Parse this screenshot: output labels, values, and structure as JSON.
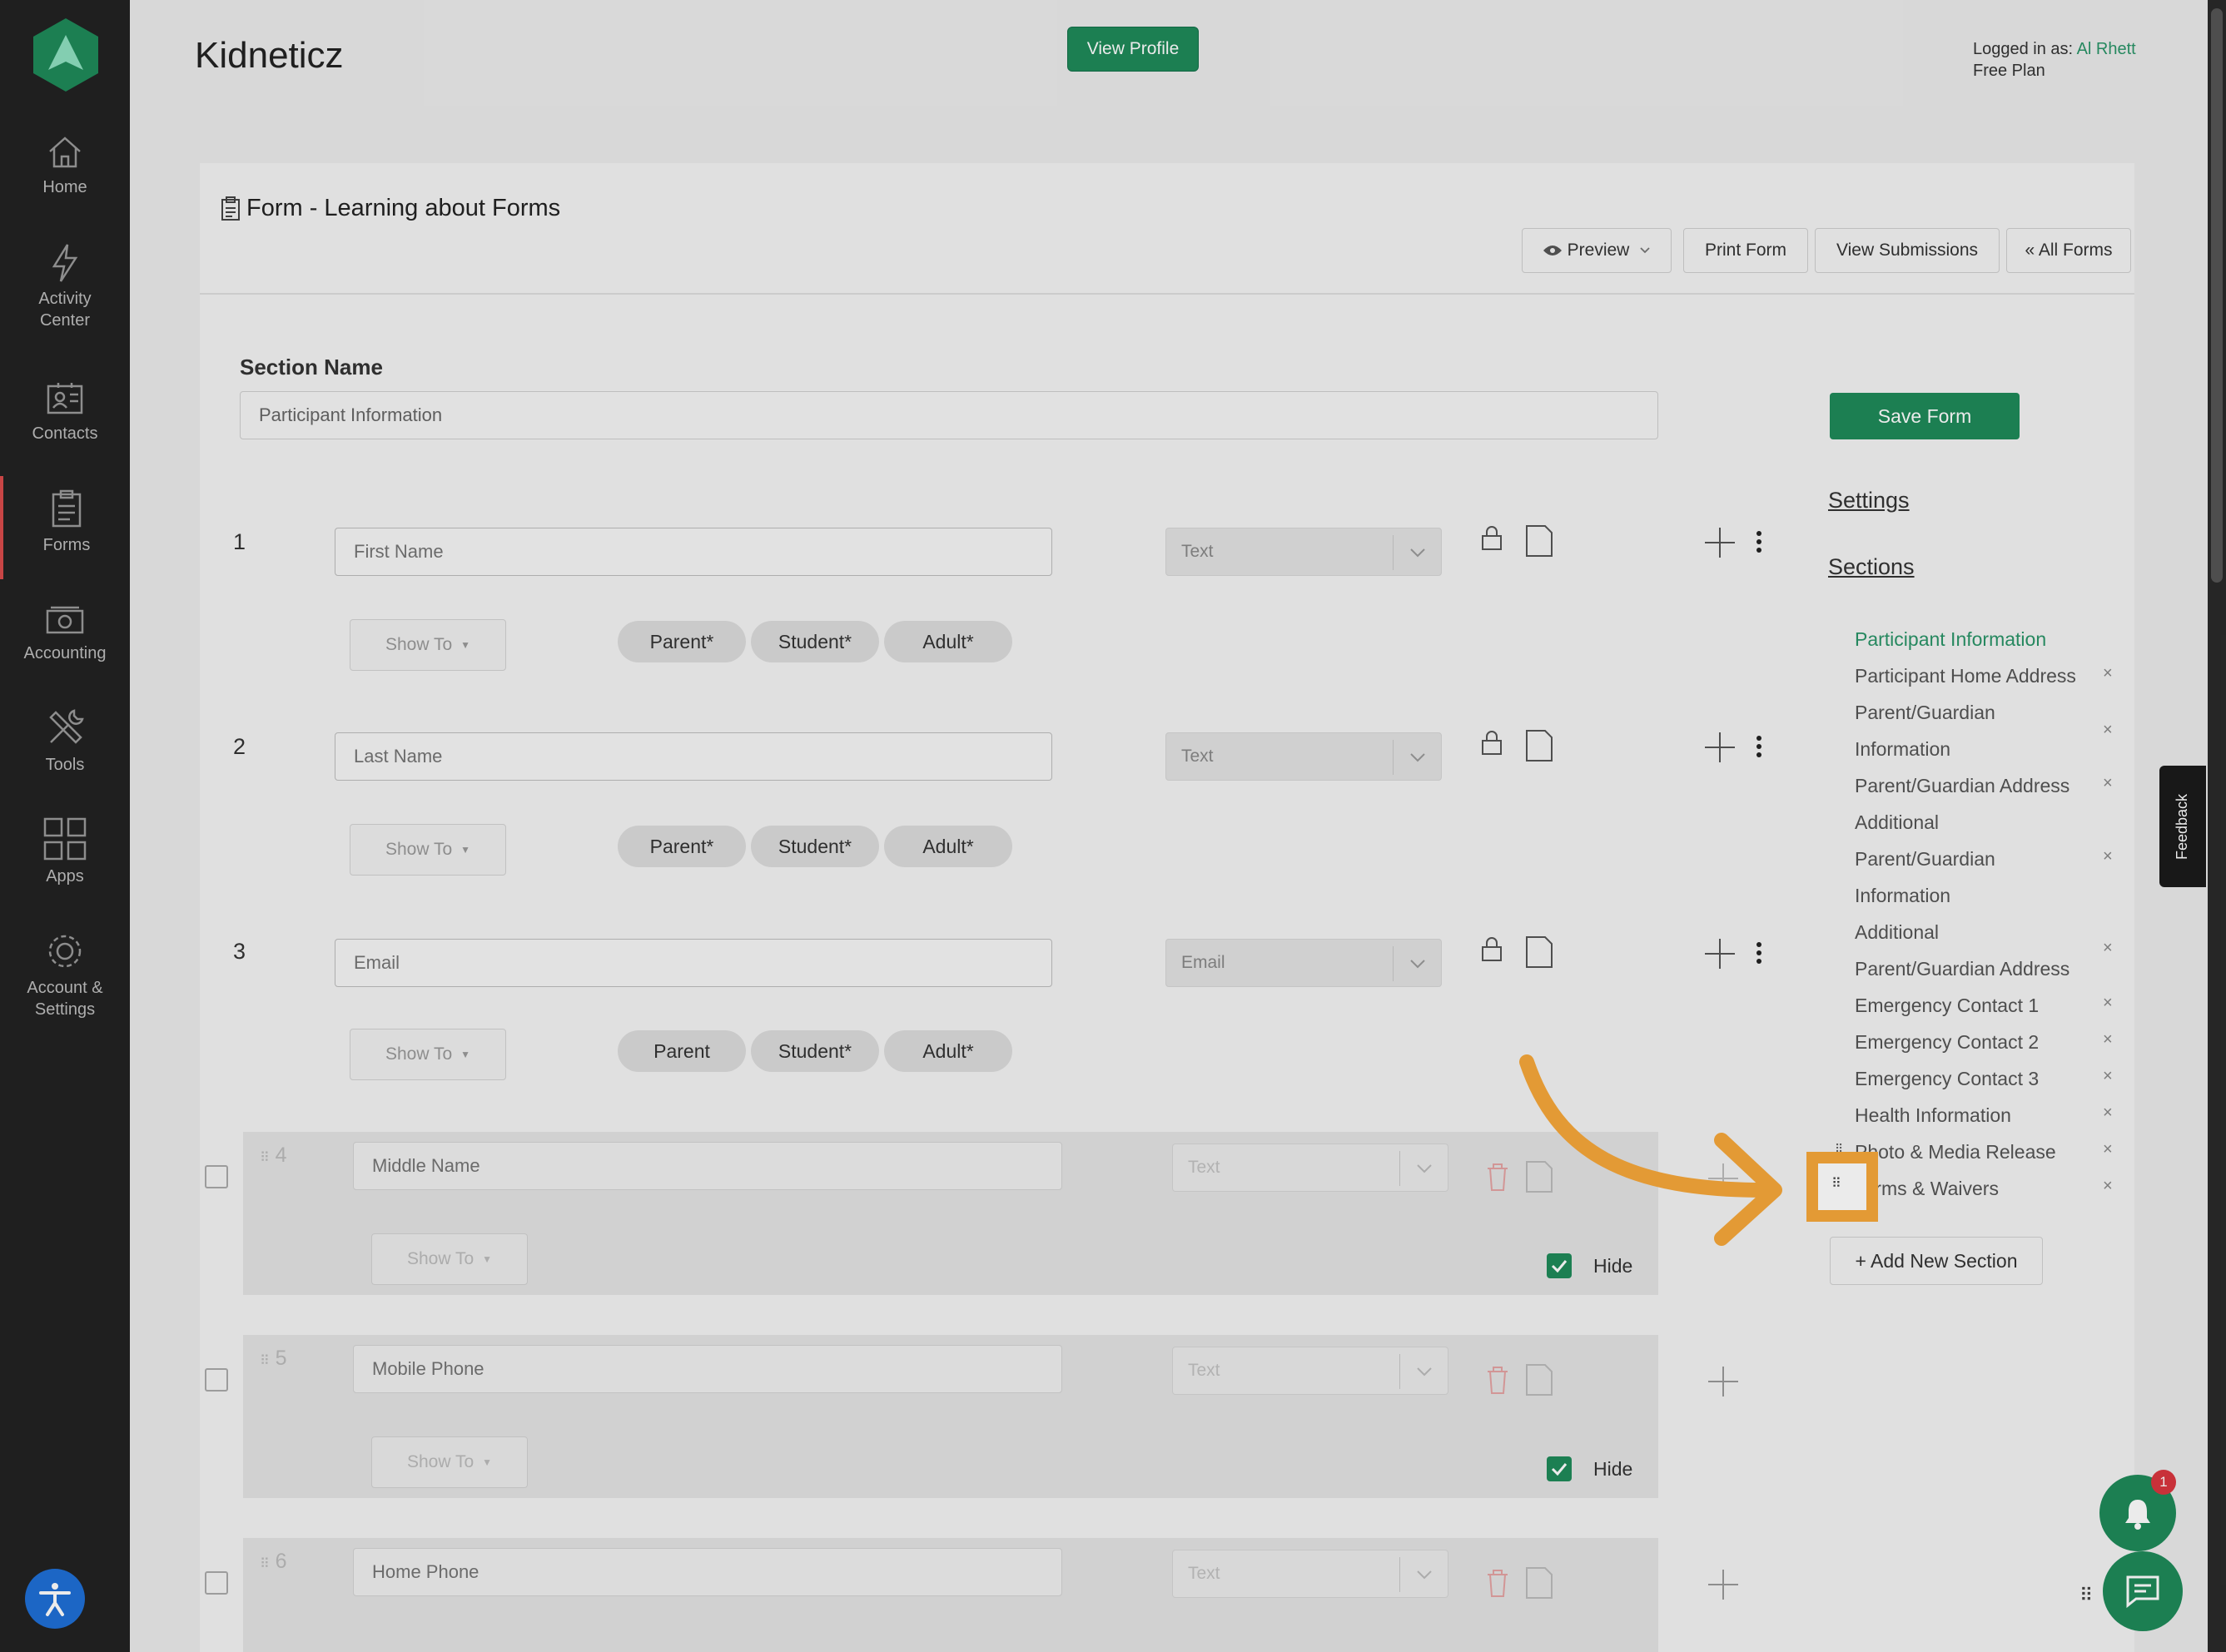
{
  "sidebar": {
    "items": [
      {
        "label": "Home",
        "icon": "home-icon"
      },
      {
        "label": "Activity Center",
        "icon": "bolt-icon"
      },
      {
        "label": "Contacts",
        "icon": "contacts-icon"
      },
      {
        "label": "Forms",
        "icon": "clipboard-icon"
      },
      {
        "label": "Accounting",
        "icon": "money-icon"
      },
      {
        "label": "Tools",
        "icon": "tools-icon"
      },
      {
        "label": "Apps",
        "icon": "apps-grid-icon"
      },
      {
        "label": "Account & Settings",
        "icon": "gear-icon"
      }
    ]
  },
  "header": {
    "title": "Kidneticz",
    "view_profile": "View Profile",
    "logged_in_prefix": "Logged in as:",
    "user": "Al Rhett",
    "plan": "Free Plan"
  },
  "form": {
    "title": "Form - Learning about Forms",
    "buttons": {
      "preview": "Preview",
      "print": "Print Form",
      "submissions": "View Submissions",
      "all_forms": "« All Forms"
    },
    "section_name_label": "Section Name",
    "section_name_value": "Participant Information",
    "save": "Save Form",
    "show_to": "Show To",
    "hide_label": "Hide",
    "fields": [
      {
        "num": "1",
        "placeholder": "First Name",
        "type": "Text",
        "chips": [
          "Parent*",
          "Student*",
          "Adult*"
        ]
      },
      {
        "num": "2",
        "placeholder": "Last Name",
        "type": "Text",
        "chips": [
          "Parent*",
          "Student*",
          "Adult*"
        ]
      },
      {
        "num": "3",
        "placeholder": "Email",
        "type": "Email",
        "chips": [
          "Parent",
          "Student*",
          "Adult*"
        ]
      },
      {
        "num": "4",
        "placeholder": "Middle Name",
        "type": "Text"
      },
      {
        "num": "5",
        "placeholder": "Mobile Phone",
        "type": "Text"
      },
      {
        "num": "6",
        "placeholder": "Home Phone",
        "type": "Text"
      }
    ]
  },
  "panel": {
    "settings": "Settings",
    "sections_heading": "Sections",
    "sections": [
      "Participant Information",
      "Participant Home Address",
      "Parent/Guardian",
      "Information",
      "Parent/Guardian Address",
      "Additional",
      "Parent/Guardian",
      "Information",
      "Additional",
      "Parent/Guardian Address",
      "Emergency Contact 1",
      "Emergency Contact 2",
      "Emergency Contact 3",
      "Health Information",
      "Photo & Media Release",
      "Terms & Waivers"
    ],
    "remove_symbol": "×",
    "add_section": "+ Add New Section"
  },
  "feedback": "Feedback",
  "notifications_count": "1",
  "colors": {
    "accent": "#1f8a5a",
    "highlight": "#f7a83a",
    "sidebar": "#222222"
  }
}
